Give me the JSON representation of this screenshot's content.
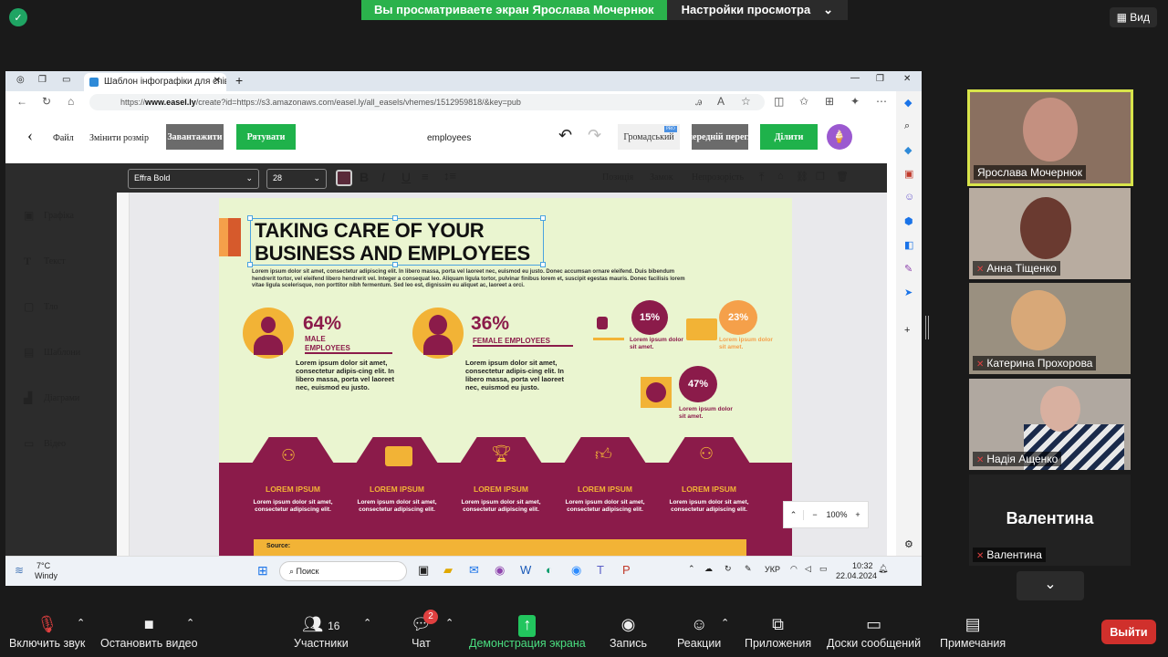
{
  "zoom": {
    "banner_text": "Вы просматриваете экран Ярослава Мочернюк",
    "view_settings": "Настройки просмотра",
    "view_label": "Вид",
    "bottom": {
      "mute": "Включить звук",
      "video": "Остановить видео",
      "participants": "Участники",
      "participants_count": "16",
      "chat": "Чат",
      "chat_badge": "2",
      "share": "Демонстрация экрана",
      "record": "Запись",
      "reactions": "Реакции",
      "apps": "Приложения",
      "whiteboards": "Доски сообщений",
      "notes": "Примечания",
      "leave": "Выйти"
    },
    "participants": [
      {
        "name": "Ярослава Мочернюк"
      },
      {
        "name": "Анна Тіщенко"
      },
      {
        "name": "Катерина Прохорова"
      },
      {
        "name": "Надія Ащенко"
      },
      {
        "name": "Валентина",
        "big_label": "Валентина"
      }
    ]
  },
  "browser": {
    "tab_title": "Шаблон інфографіки для співр",
    "url_prefix": "https://",
    "url_host": "www.easel.ly",
    "url_rest": "/create?id=https://s3.amazonaws.com/easel.ly/all_easels/vhemes/1512959818/&key=pub"
  },
  "easel": {
    "file": "Файл",
    "resize": "Змінити розмір",
    "download": "Завантажити",
    "save": "Рятувати",
    "doc_name": "employees",
    "public": "Громадський",
    "pro_badge": "PRO",
    "preview": "попередній перегляд",
    "share": "Ділити",
    "font": "Effra Bold",
    "size": "28",
    "position": "Позиція",
    "lock": "Замок",
    "opacity": "Непрозорість",
    "nav": [
      "Графіка",
      "Текст",
      "Тло",
      "Шаблони",
      "Діаграми",
      "Відео"
    ],
    "zoom": "100%"
  },
  "infographic": {
    "title_l1": "TAKING CARE OF YOUR",
    "title_l2": "BUSINESS AND EMPLOYEES",
    "intro": "Lorem ipsum dolor sit amet, consectetur adipiscing elit. In libero massa, porta vel laoreet nec, euismod eu justo. Donec accumsan ornare eleifend. Duis bibendum hendrerit tortor, vel eleifend libero hendrerit vel. Integer a consequat leo. Aliquam ligula tortor, pulvinar finibus lorem et, suscipit egestas mauris. Donec facilisis lorem vitae ligula scelerisque, non porttitor nibh fermentum. Sed leo est, dignissim eu aliquet ac, laoreet a orci.",
    "male_pct": "64%",
    "male_label_1": "MALE",
    "male_label_2": "EMPLOYEES",
    "female_pct": "36%",
    "female_label": "FEMALE EMPLOYEES",
    "para": "Lorem ipsum dolor sit amet, consectetur adipis-cing elit. In libero massa, porta vel laoreet nec, euismod eu justo.",
    "stat1": "15%",
    "stat2": "23%",
    "stat3": "47%",
    "stat_caption": "Lorem ipsum dolor sit amet.",
    "band_title": "LOREM IPSUM",
    "band_text": "Lorem ipsum dolor sit amet, consectetur adipiscing elit.",
    "source": "Source:"
  },
  "taskbar": {
    "temp": "7°C",
    "weather": "Windy",
    "search": "Поиск",
    "lang": "УКР",
    "time": "10:32",
    "date": "22.04.2024"
  },
  "colors": {
    "accent": "#8b1b4a",
    "gold": "#f2b336",
    "green": "#1fb24b",
    "bg": "#eaf5d0"
  }
}
